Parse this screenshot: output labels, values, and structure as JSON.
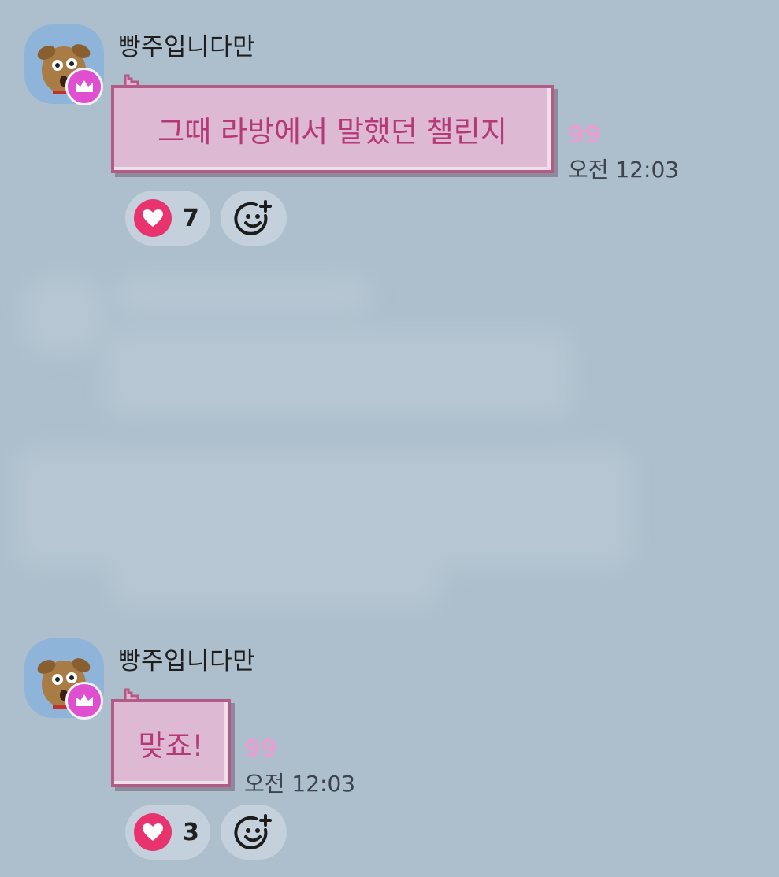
{
  "messages": [
    {
      "sender": "빵주입니다만",
      "text": "그때 라방에서 말했던 챌린지",
      "unread_count": "99",
      "time": "오전 12:03",
      "reactions": {
        "heart_count": "7"
      }
    },
    {
      "sender": "빵주입니다만",
      "text": "맞죠!",
      "unread_count": "99",
      "time": "오전 12:03",
      "reactions": {
        "heart_count": "3"
      }
    }
  ],
  "icons": {
    "avatar": "dog-avatar-icon",
    "crown": "crown-icon",
    "heart": "heart-icon",
    "add_reaction": "add-emoji-icon"
  },
  "colors": {
    "background": "#adbfcd",
    "bubble_fill": "#ddb9d4",
    "bubble_text": "#b53877",
    "bubble_border": "#b45a86",
    "unread_count": "#e69fd0",
    "heart": "#e8336f",
    "crown_badge": "#e04fcf"
  }
}
